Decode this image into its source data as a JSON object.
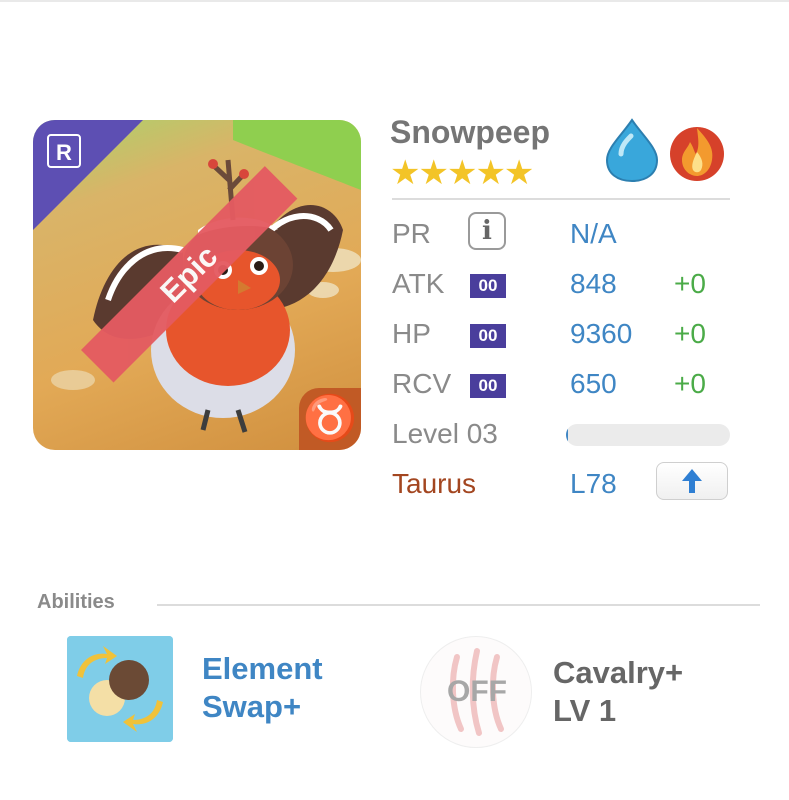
{
  "pet": {
    "name": "Snowpeep",
    "stars": "★★★★★",
    "rarity": "Epic",
    "badge": "R",
    "zodiac_symbol": "♉",
    "elements": [
      "water-drop-icon",
      "fire-icon"
    ]
  },
  "stats": {
    "pr": {
      "label": "PR",
      "value": "N/A"
    },
    "atk": {
      "label": "ATK",
      "tag": "00",
      "value": "848",
      "bonus": "+0"
    },
    "hp": {
      "label": "HP",
      "tag": "00",
      "value": "9360",
      "bonus": "+0"
    },
    "rcv": {
      "label": "RCV",
      "tag": "00",
      "value": "650",
      "bonus": "+0"
    },
    "level": {
      "label": "Level 03",
      "progress": 0.01
    },
    "zodiac": {
      "label": "Taurus",
      "value": "L78"
    }
  },
  "abilities": {
    "title": "Abilities",
    "items": [
      {
        "name_line1": "Element",
        "name_line2": "Swap+",
        "icon": "element-swap-icon"
      },
      {
        "name_line1": "Cavalry+",
        "name_line2": "LV 1",
        "status": "OFF",
        "icon": "claw-scratch-icon"
      }
    ]
  },
  "colors": {
    "accent_blue": "#3f86c4",
    "bonus_green": "#4bab48",
    "epic_ribbon": "#e45b61",
    "rare_badge_purple": "#5d4fb3",
    "zodiac_orange": "#c15a25",
    "star_gold": "#f3c427"
  }
}
